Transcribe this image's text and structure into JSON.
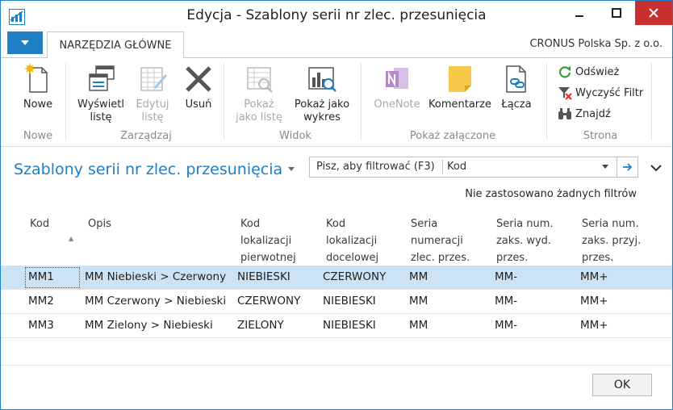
{
  "window": {
    "title": "Edycja - Szablony serii nr zlec. przesunięcia"
  },
  "ribbon": {
    "active_tab": "NARZĘDZIA GŁÓWNE",
    "company": "CRONUS Polska Sp. z o.o.",
    "groups": {
      "nowe": {
        "label": "Nowe",
        "new_btn": "Nowe"
      },
      "zarzadzaj": {
        "label": "Zarządzaj",
        "view_line1": "Wyświetl",
        "view_line2": "listę",
        "edit_line1": "Edytuj",
        "edit_line2": "listę",
        "delete": "Usuń"
      },
      "widok": {
        "label": "Widok",
        "show_list_line1": "Pokaż",
        "show_list_line2": "jako listę",
        "show_chart_line1": "Pokaż jako",
        "show_chart_line2": "wykres"
      },
      "zalaczone": {
        "label": "Pokaż załączone",
        "onenote": "OneNote",
        "comments": "Komentarze",
        "links": "Łącza"
      },
      "strona": {
        "label": "Strona",
        "refresh": "Odśwież",
        "clear_filter": "Wyczyść Filtr",
        "find": "Znajdź"
      }
    }
  },
  "page": {
    "title": "Szablony serii nr zlec. przesunięcia",
    "filter_placeholder": "Pisz, aby filtrować (F3)",
    "filter_field": "Kod",
    "no_filters": "Nie zastosowano żadnych filtrów"
  },
  "table": {
    "headers": {
      "kod": "Kod",
      "opis": "Opis",
      "lok_pierw_1": "Kod",
      "lok_pierw_2": "lokalizacji",
      "lok_pierw_3": "pierwotnej",
      "lok_doc_1": "Kod",
      "lok_doc_2": "lokalizacji",
      "lok_doc_3": "docelowej",
      "seria_1": "Seria",
      "seria_2": "numeracji",
      "seria_3": "zlec. przes.",
      "wyd_1": "Seria num.",
      "wyd_2": "zaks. wyd.",
      "wyd_3": "przes.",
      "przyj_1": "Seria num.",
      "przyj_2": "zaks. przyj.",
      "przyj_3": "przes."
    },
    "rows": [
      {
        "kod": "MM1",
        "opis": "MM Niebieski > Czerwony",
        "from": "NIEBIESKI",
        "to": "CZERWONY",
        "seria": "MM",
        "wyd": "MM-",
        "przyj": "MM+"
      },
      {
        "kod": "MM2",
        "opis": "MM Czerwony > Niebieski",
        "from": "CZERWONY",
        "to": "NIEBIESKI",
        "seria": "MM",
        "wyd": "MM-",
        "przyj": "MM+"
      },
      {
        "kod": "MM3",
        "opis": "MM Zielony > Niebieski",
        "from": "ZIELONY",
        "to": "NIEBIESKI",
        "seria": "MM",
        "wyd": "MM-",
        "przyj": "MM+"
      }
    ]
  },
  "footer": {
    "ok": "OK"
  },
  "colors": {
    "accent": "#1e7fc4",
    "selected_row": "#cde2f2",
    "close": "#c7302e"
  }
}
